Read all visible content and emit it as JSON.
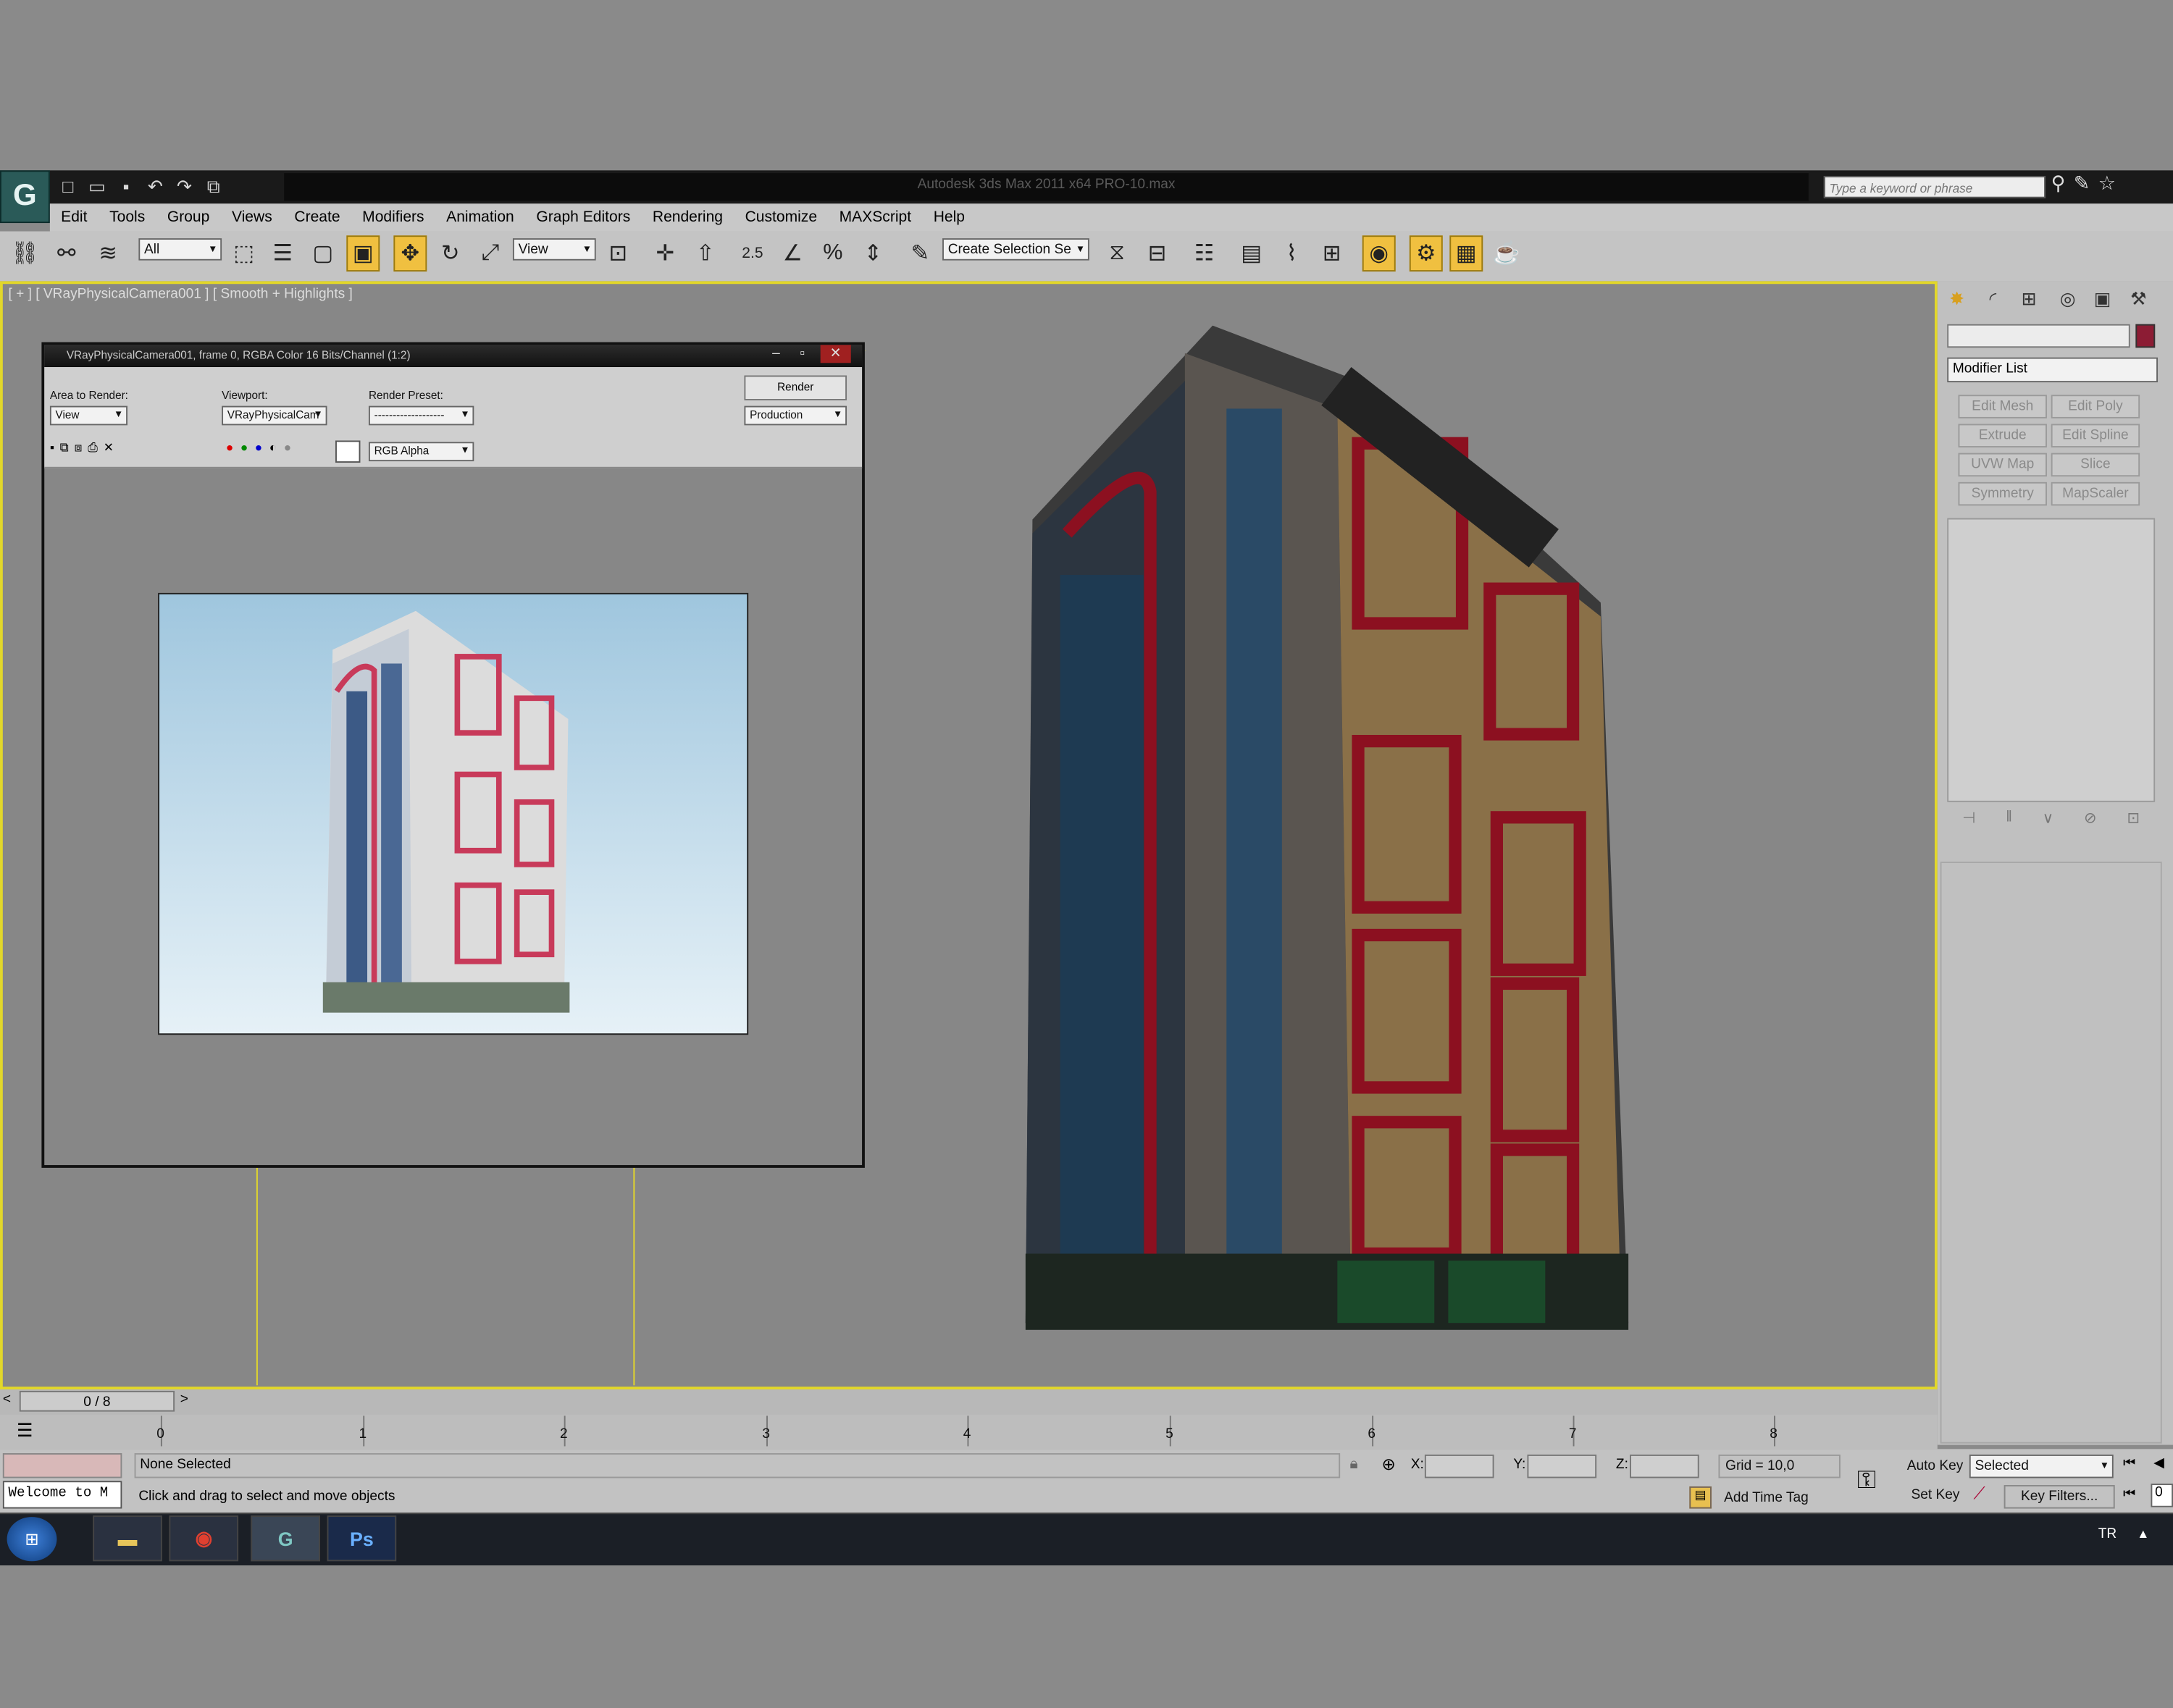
{
  "window": {
    "title": "Autodesk 3ds Max  2011 x64      PRO-10.max"
  },
  "search": {
    "placeholder": "Type a keyword or phrase"
  },
  "menu": [
    "Edit",
    "Tools",
    "Group",
    "Views",
    "Create",
    "Modifiers",
    "Animation",
    "Graph Editors",
    "Rendering",
    "Customize",
    "MAXScript",
    "Help"
  ],
  "toolbar": {
    "selection_filter": "All",
    "ref_coord": "View",
    "named_selection": "Create Selection Se",
    "snap_label": "2.5"
  },
  "viewport": {
    "label_left": "[ + ] [ VRayPhysicalCamera001 ] [ Smooth + Highlights ]",
    "label_right": "[ + ] [ VRayPhysicalCamera001 ] [ Smooth + Highlights ]"
  },
  "render_window": {
    "title": "VRayPhysicalCamera001, frame 0, RGBA Color 16 Bits/Channel (1:2)",
    "area_label": "Area to Render:",
    "area_value": "View",
    "viewport_label": "Viewport:",
    "viewport_value": "VRayPhysicalCam",
    "preset_label": "Render Preset:",
    "preset_value": "-------------------",
    "render_button": "Render",
    "production_value": "Production",
    "channel_value": "RGB Alpha"
  },
  "command_panel": {
    "modifier_list": "Modifier List",
    "buttons": [
      "Edit Mesh",
      "Edit Poly",
      "Extrude",
      "Edit Spline",
      "UVW Map",
      "Slice",
      "Symmetry",
      "MapScaler"
    ]
  },
  "timeline": {
    "slider": "0 / 8",
    "ticks": [
      "0",
      "1",
      "2",
      "3",
      "4",
      "5",
      "6",
      "7",
      "8"
    ]
  },
  "status": {
    "welcome": "Welcome to M",
    "selection": "None Selected",
    "prompt": "Click and drag to select and move objects",
    "x_label": "X:",
    "y_label": "Y:",
    "z_label": "Z:",
    "grid": "Grid = 10,0",
    "add_time_tag": "Add Time Tag",
    "auto_key": "Auto Key",
    "selected": "Selected",
    "set_key": "Set Key",
    "key_filters": "Key Filters...",
    "frame_value": "0"
  },
  "taskbar": {
    "apps": [
      "explorer",
      "chrome",
      "3dsmax",
      "photoshop"
    ],
    "photoshop_label": "Ps",
    "tray_lang": "TR"
  },
  "colors": {
    "viewport_border": "#e2d72a",
    "accent_selected": "#f0c040",
    "swatch": "#8c1c34"
  }
}
